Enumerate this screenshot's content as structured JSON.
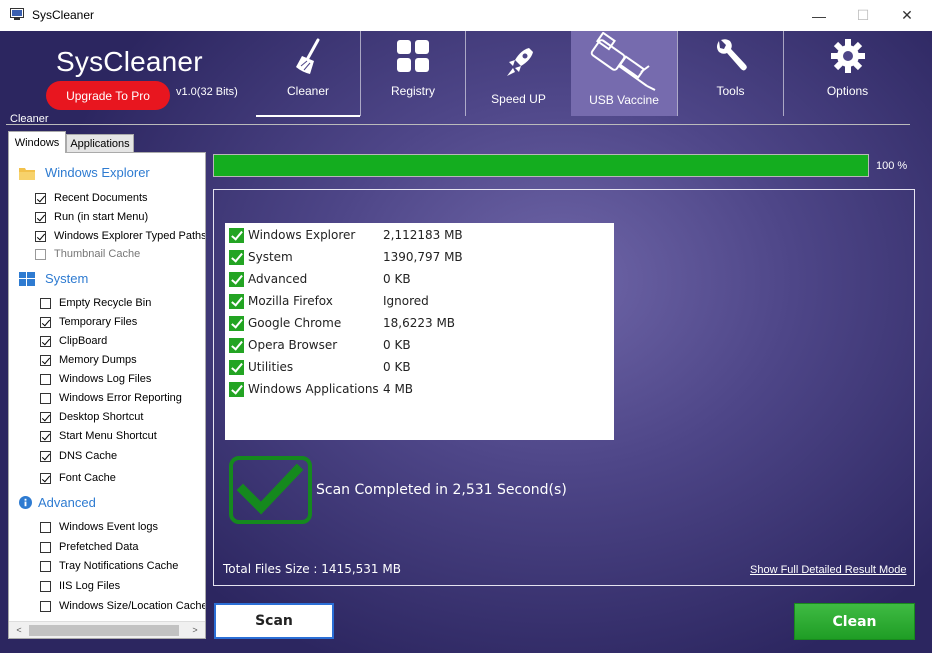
{
  "window": {
    "title": "SysCleaner",
    "minimize": "—",
    "maximize": "☐",
    "close": "✕"
  },
  "header": {
    "brand": "SysCleaner",
    "upgrade_label": "Upgrade To Pro",
    "version": "v1.0(32 Bits)",
    "nav": [
      {
        "label": "Cleaner",
        "icon": "broom-icon"
      },
      {
        "label": "Registry",
        "icon": "grid-icon"
      },
      {
        "label": "Speed UP",
        "icon": "rocket-icon"
      },
      {
        "label": "USB Vaccine",
        "icon": "usb-syringe-icon"
      },
      {
        "label": "Tools",
        "icon": "wrench-icon"
      },
      {
        "label": "Options",
        "icon": "gear-icon"
      }
    ]
  },
  "group_label": "Cleaner",
  "tabs": [
    {
      "label": "Windows",
      "active": true
    },
    {
      "label": "Applications",
      "active": false
    }
  ],
  "sections": {
    "windows_explorer": {
      "title": "Windows Explorer",
      "items": [
        {
          "label": "Recent Documents",
          "checked": true
        },
        {
          "label": "Run (in start Menu)",
          "checked": true
        },
        {
          "label": "Windows Explorer Typed Paths",
          "checked": true
        },
        {
          "label": "Thumbnail Cache",
          "checked": false,
          "disabled": true
        }
      ]
    },
    "system": {
      "title": "System",
      "items": [
        {
          "label": "Empty Recycle Bin",
          "checked": false
        },
        {
          "label": "Temporary Files",
          "checked": true
        },
        {
          "label": "ClipBoard",
          "checked": true
        },
        {
          "label": "Memory Dumps",
          "checked": true
        },
        {
          "label": "Windows Log Files",
          "checked": false
        },
        {
          "label": "Windows Error Reporting",
          "checked": false
        },
        {
          "label": "Desktop Shortcut",
          "checked": true
        },
        {
          "label": "Start Menu Shortcut",
          "checked": true
        },
        {
          "label": "DNS Cache",
          "checked": true
        },
        {
          "label": "Font Cache",
          "checked": true
        }
      ]
    },
    "advanced": {
      "title": "Advanced",
      "items": [
        {
          "label": "Windows Event logs",
          "checked": false
        },
        {
          "label": "Prefetched Data",
          "checked": false
        },
        {
          "label": "Tray Notifications Cache",
          "checked": false
        },
        {
          "label": "IIS Log Files",
          "checked": false
        },
        {
          "label": "Windows Size/Location Cache",
          "checked": false
        }
      ]
    }
  },
  "scrollbar": {
    "left_arrow": "<",
    "right_arrow": ">"
  },
  "progress": {
    "value": 100,
    "label": "100 %"
  },
  "results": [
    {
      "name": "Windows Explorer",
      "value": "2,112183 MB"
    },
    {
      "name": "System",
      "value": "1390,797 MB"
    },
    {
      "name": "Advanced",
      "value": "0 KB"
    },
    {
      "name": "Mozilla Firefox",
      "value": "Ignored"
    },
    {
      "name": "Google Chrome",
      "value": "18,6223 MB"
    },
    {
      "name": "Opera Browser",
      "value": "0 KB"
    },
    {
      "name": "Utilities",
      "value": "0 KB"
    },
    {
      "name": "Windows Applications",
      "value": "4 MB"
    }
  ],
  "scan_message": "Scan Completed in 2,531 Second(s)",
  "total_size": "Total Files Size : 1415,531 MB",
  "detail_link": "Show Full Detailed Result Mode",
  "buttons": {
    "scan": "Scan",
    "clean": "Clean"
  },
  "colors": {
    "accent_green": "#14ad1f",
    "upgrade_red": "#e8161f",
    "section_blue": "#2e7bd1",
    "scan_border": "#2b6fd6"
  }
}
